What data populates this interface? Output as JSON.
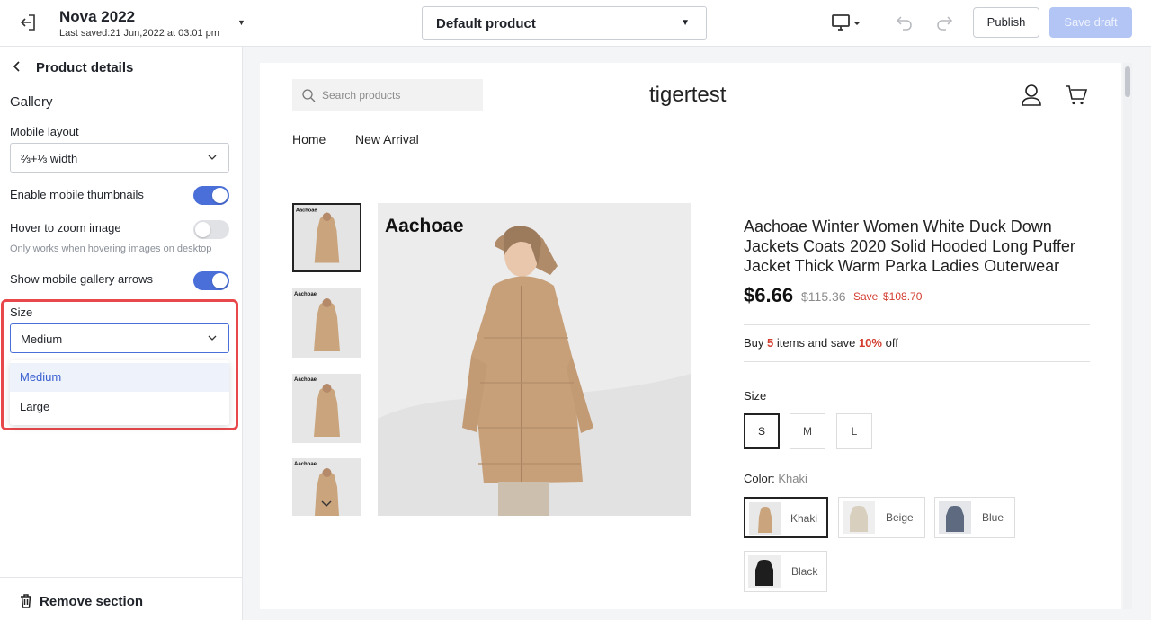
{
  "topbar": {
    "theme_name": "Nova 2022",
    "last_saved": "Last saved:21 Jun,2022 at 03:01 pm",
    "product_select": "Default product",
    "publish_label": "Publish",
    "save_draft_label": "Save draft",
    "icons": [
      "exit-icon",
      "desktop-icon",
      "undo-icon",
      "redo-icon"
    ]
  },
  "sidebar": {
    "title": "Product details",
    "section": "Gallery",
    "mobile_layout": {
      "label": "Mobile layout",
      "value": "⅔+⅓ width"
    },
    "enable_thumbnails": {
      "label": "Enable mobile thumbnails",
      "on": true
    },
    "hover_zoom": {
      "label": "Hover to zoom image",
      "on": false,
      "help": "Only works when hovering images on desktop"
    },
    "gallery_arrows": {
      "label": "Show mobile gallery  arrows",
      "on": true
    },
    "size": {
      "label": "Size",
      "value": "Medium",
      "options": [
        "Medium",
        "Large"
      ]
    },
    "footer": {
      "remove_label": "Remove section"
    },
    "colors": {
      "accent": "#4a6fd9",
      "highlight": "#e8484b"
    }
  },
  "preview": {
    "search_placeholder": "Search products",
    "store_name": "tigertest",
    "nav": [
      "Home",
      "New Arrival"
    ],
    "brand_tag": "Aachoae",
    "thumb_brand": "Aachoae",
    "product": {
      "title": "Aachoae Winter Women White Duck Down Jackets Coats 2020 Solid Hooded Long Puffer Jacket Thick Warm Parka Ladies Outerwear",
      "price": "$6.66",
      "compare_price": "$115.36",
      "save_label": "Save",
      "save_amount": "$108.70",
      "bundle": {
        "prefix": "Buy",
        "qty": "5",
        "mid": "items and save",
        "pct": "10%",
        "suffix": "off"
      },
      "size_label": "Size",
      "sizes": [
        "S",
        "M",
        "L"
      ],
      "selected_size": "S",
      "color_label": "Color:",
      "color_value": "Khaki",
      "colors": [
        "Khaki",
        "Beige",
        "Blue",
        "Black"
      ]
    }
  }
}
